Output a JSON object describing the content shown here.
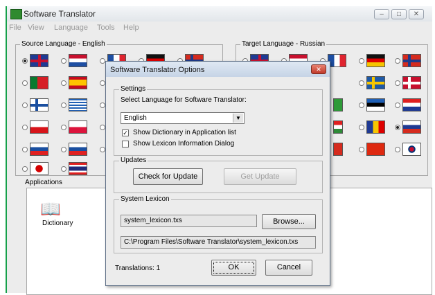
{
  "window": {
    "title": "Software Translator",
    "menu": [
      "File",
      "View",
      "Language",
      "Tools",
      "Help"
    ],
    "controls": {
      "minimize": "–",
      "maximize": "□",
      "close": "✕"
    }
  },
  "source_language": {
    "label": "Source Language - English"
  },
  "target_language": {
    "label": "Target Language - Russian"
  },
  "applications": {
    "label": "Applications",
    "items": [
      {
        "name": "Dictionary",
        "icon": "book-icon"
      }
    ]
  },
  "dialog": {
    "title": "Software Translator Options",
    "close": "✕",
    "settings": {
      "label": "Settings",
      "select_label": "Select Language for Software Translator:",
      "select_value": "English",
      "select_arrow": "▼",
      "checkbox_dictionary": {
        "label": "Show Dictionary in Application list",
        "checked": true,
        "mark": "✓"
      },
      "checkbox_lexicon": {
        "label": "Show Lexicon Information Dialog",
        "checked": false
      }
    },
    "updates": {
      "label": "Updates",
      "check_button": "Check for Update",
      "get_button": "Get Update"
    },
    "system_lexicon": {
      "label": "System Lexicon",
      "file_value": "system_lexicon.txs",
      "browse_button": "Browse...",
      "path_value": "C:\\Program Files\\Software Translator\\system_lexicon.txs"
    },
    "translations": "Translations: 1",
    "ok_button": "OK",
    "cancel_button": "Cancel"
  },
  "colors": {
    "accent": "#15a04a",
    "dialog_title": "#c6d4e6",
    "close": "#c0392b"
  }
}
